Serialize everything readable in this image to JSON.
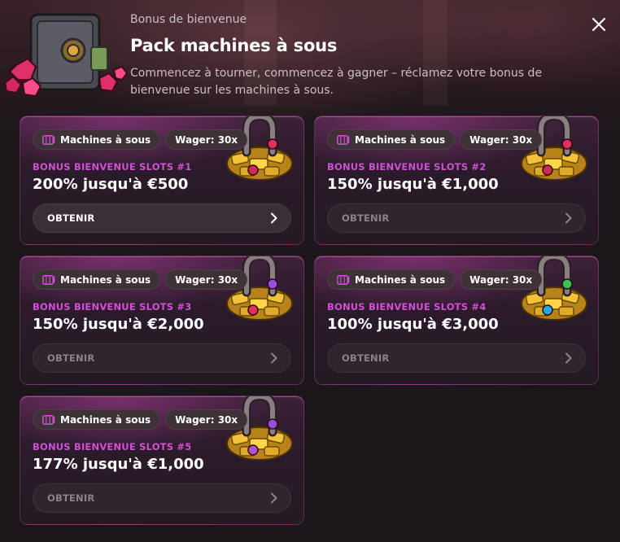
{
  "header": {
    "subtitle": "Bonus de bienvenue",
    "title": "Pack machines à sous",
    "description": "Commencez à tourner, commencez à gagner – réclamez votre bonus de bienvenue sur les machines à sous."
  },
  "icons": {
    "close": "close-icon",
    "tag": "slot-machine-icon",
    "arrow": "chevron-right-icon",
    "header_image": "safe-with-gems-icon",
    "card_image": "horseshoe-gold-icon"
  },
  "colors": {
    "accent": "#d24fd6",
    "card_border": "#be50aa",
    "background": "#1b1418"
  },
  "cards": [
    {
      "tag_category": "Machines à sous",
      "tag_wager": "Wager: 30x",
      "label": "BONUS BIENVENUE SLOTS #1",
      "amount": "200% jusqu'à €500",
      "button": "OBTENIR",
      "gems": [
        "#e0305a",
        "#d02a50"
      ]
    },
    {
      "tag_category": "Machines à sous",
      "tag_wager": "Wager: 30x",
      "label": "BONUS BIENVENUE SLOTS #2",
      "amount": "150% jusqu'à €1,000",
      "button": "OBTENIR",
      "gems": [
        "#e0305a",
        "#d02a50"
      ]
    },
    {
      "tag_category": "Machines à sous",
      "tag_wager": "Wager: 30x",
      "label": "BONUS BIENVENUE SLOTS #3",
      "amount": "150% jusqu'à €2,000",
      "button": "OBTENIR",
      "gems": [
        "#9b4fe0",
        "#e0305a"
      ]
    },
    {
      "tag_category": "Machines à sous",
      "tag_wager": "Wager: 30x",
      "label": "BONUS BIENVENUE SLOTS #4",
      "amount": "100% jusqu'à €3,000",
      "button": "OBTENIR",
      "gems": [
        "#3cc24a",
        "#27a8e0"
      ]
    },
    {
      "tag_category": "Machines à sous",
      "tag_wager": "Wager: 30x",
      "label": "BONUS BIENVENUE SLOTS #5",
      "amount": "177% jusqu'à €1,000",
      "button": "OBTENIR",
      "gems": [
        "#9b4fe0",
        "#b44fd0"
      ]
    }
  ]
}
